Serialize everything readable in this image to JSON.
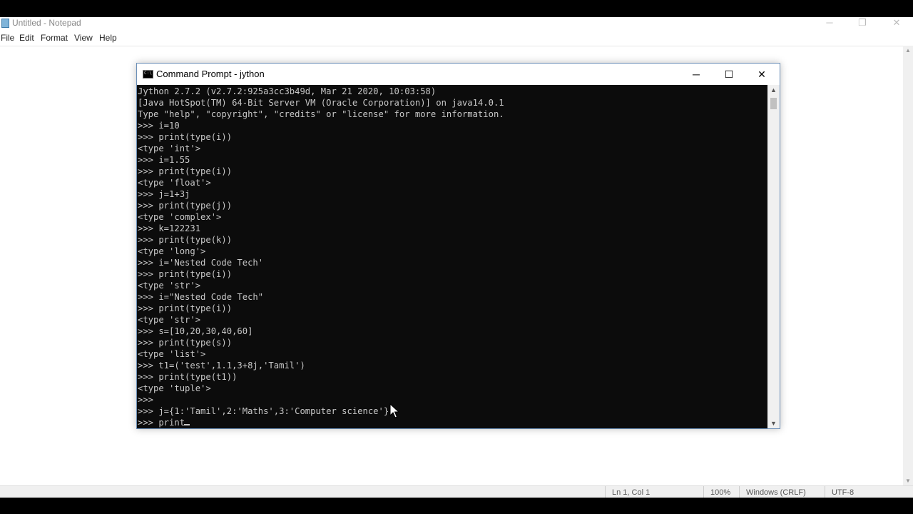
{
  "notepad": {
    "title": "Untitled - Notepad",
    "menu": [
      "File",
      "Edit",
      "Format",
      "View",
      "Help"
    ],
    "controls": {
      "minimize": "─",
      "restore": "❐",
      "close": "✕"
    },
    "status": {
      "position": "Ln 1, Col 1",
      "zoom": "100%",
      "line_ending": "Windows (CRLF)",
      "encoding": "UTF-8"
    }
  },
  "cmd": {
    "title": "Command Prompt - jython",
    "icon_label": "C:\\",
    "controls": {
      "minimize": "─",
      "maximize": "☐",
      "close": "✕"
    },
    "lines": [
      "Jython 2.7.2 (v2.7.2:925a3cc3b49d, Mar 21 2020, 10:03:58)",
      "[Java HotSpot(TM) 64-Bit Server VM (Oracle Corporation)] on java14.0.1",
      "Type \"help\", \"copyright\", \"credits\" or \"license\" for more information.",
      ">>> i=10",
      ">>> print(type(i))",
      "<type 'int'>",
      ">>> i=1.55",
      ">>> print(type(i))",
      "<type 'float'>",
      ">>> j=1+3j",
      ">>> print(type(j))",
      "<type 'complex'>",
      ">>> k=122231",
      ">>> print(type(k))",
      "<type 'long'>",
      ">>> i='Nested Code Tech'",
      ">>> print(type(i))",
      "<type 'str'>",
      ">>> i=\"Nested Code Tech\"",
      ">>> print(type(i))",
      "<type 'str'>",
      ">>> s=[10,20,30,40,60]",
      ">>> print(type(s))",
      "<type 'list'>",
      ">>> t1=('test',1.1,3+8j,'Tamil')",
      ">>> print(type(t1))",
      "<type 'tuple'>",
      ">>>",
      ">>> j={1:'Tamil',2:'Maths',3:'Computer science'}",
      ">>> print"
    ]
  }
}
